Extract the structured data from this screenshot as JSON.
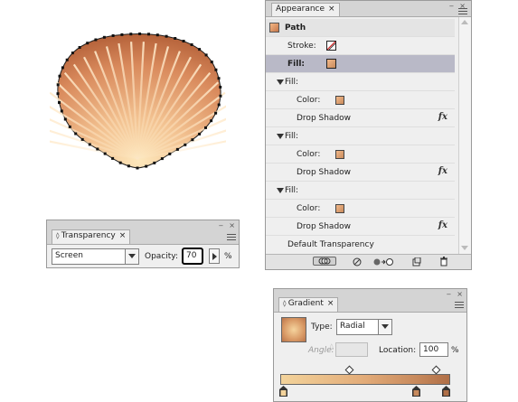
{
  "appearance": {
    "tab_label": "Appearance",
    "header_title": "Path",
    "stroke_label": "Stroke:",
    "fill_label": "Fill:",
    "fill_groups": [
      {
        "title": "Fill:",
        "color_label": "Color:",
        "effect": "Drop Shadow",
        "fx": "fx"
      },
      {
        "title": "Fill:",
        "color_label": "Color:",
        "effect": "Drop Shadow",
        "fx": "fx"
      },
      {
        "title": "Fill:",
        "color_label": "Color:",
        "effect": "Drop Shadow",
        "fx": "fx"
      }
    ],
    "default_transparency": "Default Transparency",
    "close_glyph": "×",
    "minimize_glyph": "‒"
  },
  "transparency": {
    "tab_label": "Transparency",
    "blend_mode": "Screen",
    "opacity_label": "Opacity:",
    "opacity_value": "70",
    "percent": "%"
  },
  "gradient": {
    "tab_label": "Gradient",
    "type_label": "Type:",
    "type_value": "Radial",
    "angle_label": "Angle:",
    "location_label": "Location:",
    "location_value": "100",
    "percent": "%",
    "stops_colors": [
      "#f3d39b",
      "#c88a5d",
      "#b06f47"
    ]
  },
  "colors": {
    "fill_swatch": "#d6916a",
    "selected_row": "#b9b9c7",
    "shell_light": "#fde3b6",
    "shell_dark": "#c06a3c"
  }
}
